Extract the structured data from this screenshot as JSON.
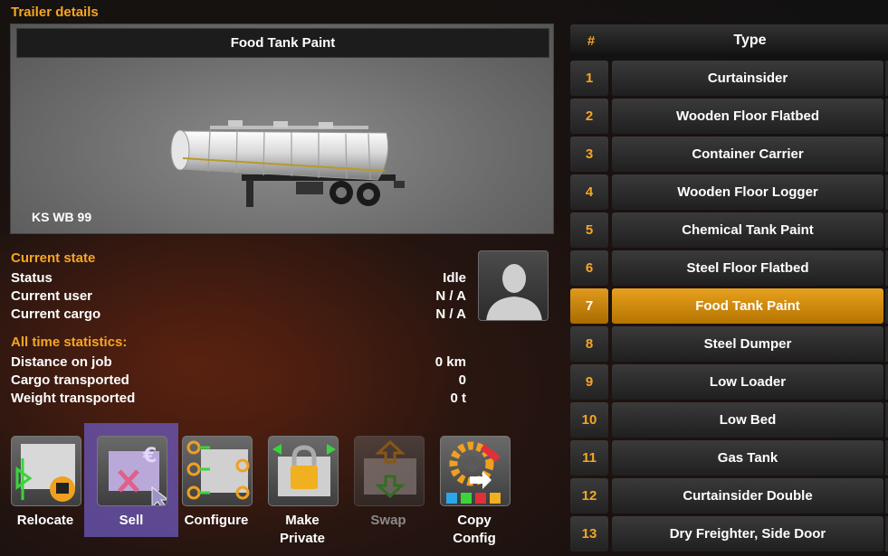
{
  "colors": {
    "accent": "#f6a623",
    "selected_row": "#d8930f",
    "selected_action": "#6e5abe"
  },
  "left": {
    "section_title": "Trailer details",
    "trailer_name": "Food Tank Paint",
    "plate": "KS WB 99",
    "current_state": {
      "title": "Current state",
      "rows": [
        {
          "label": "Status",
          "value": "Idle"
        },
        {
          "label": "Current user",
          "value": "N / A"
        },
        {
          "label": "Current cargo",
          "value": "N / A"
        }
      ]
    },
    "statistics": {
      "title": "All time statistics:",
      "rows": [
        {
          "label": "Distance on job",
          "value": "0 km"
        },
        {
          "label": "Cargo transported",
          "value": "0"
        },
        {
          "label": "Weight transported",
          "value": "0 t"
        }
      ]
    },
    "avatar_icon": "user-silhouette-icon"
  },
  "actions": [
    {
      "label": "Relocate",
      "icon": "relocate-icon",
      "state": "normal"
    },
    {
      "label": "Sell",
      "icon": "sell-icon",
      "state": "selected"
    },
    {
      "label": "Configure",
      "icon": "configure-icon",
      "state": "normal"
    },
    {
      "label": "Make Private",
      "label_lines": [
        "Make",
        "Private"
      ],
      "icon": "lock-icon",
      "state": "normal"
    },
    {
      "label": "Swap",
      "icon": "swap-icon",
      "state": "disabled"
    },
    {
      "label": "Copy Config",
      "label_lines": [
        "Copy",
        "Config"
      ],
      "icon": "copy-config-icon",
      "state": "normal"
    }
  ],
  "table": {
    "headers": {
      "num": "#",
      "type": "Type"
    },
    "rows": [
      {
        "num": "1",
        "type": "Curtainsider"
      },
      {
        "num": "2",
        "type": "Wooden Floor Flatbed"
      },
      {
        "num": "3",
        "type": "Container Carrier"
      },
      {
        "num": "4",
        "type": "Wooden Floor Logger"
      },
      {
        "num": "5",
        "type": "Chemical Tank Paint"
      },
      {
        "num": "6",
        "type": "Steel Floor Flatbed"
      },
      {
        "num": "7",
        "type": "Food Tank Paint",
        "selected": true
      },
      {
        "num": "8",
        "type": "Steel Dumper"
      },
      {
        "num": "9",
        "type": "Low Loader"
      },
      {
        "num": "10",
        "type": "Low Bed"
      },
      {
        "num": "11",
        "type": "Gas Tank"
      },
      {
        "num": "12",
        "type": "Curtainsider Double"
      },
      {
        "num": "13",
        "type": "Dry Freighter, Side Door"
      }
    ]
  }
}
